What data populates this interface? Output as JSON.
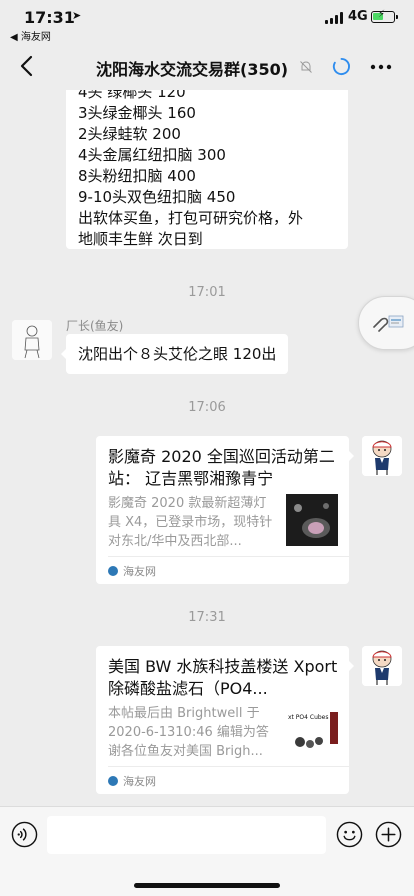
{
  "status_bar": {
    "time": "17:31",
    "back_app": "◀ 海友网",
    "network": "4G",
    "battery_charging": true
  },
  "nav": {
    "title": "沈阳海水交流交易群(350)"
  },
  "messages": {
    "top_bubble_lines": [
      "4头 绿椰头 120",
      "3头绿金椰头 160",
      "2头绿蛙软 200",
      "4头金属红纽扣脑 300",
      "8头粉纽扣脑 400",
      "9-10头双色纽扣脑 450",
      "出软体买鱼，打包可研究价格，外",
      "地顺丰生鲜 次日到"
    ],
    "time1": "17:01",
    "sender_name": "厂长(鱼友)",
    "left_bubble": "沈阳出个８头艾伦之眼 120出",
    "time2": "17:06",
    "card1": {
      "title": "影魔奇 2020 全国巡回活动第二站： 辽吉黑鄂湘豫青宁",
      "description": "影魔奇 2020 款最新超薄灯具 X4，已登录市场，现特针对东北/华中及西北部...",
      "source": "海友网"
    },
    "time3": "17:31",
    "card2": {
      "title": "美国 BW 水族科技盖楼送 Xport 除磷酸盐滤石（PO4...",
      "description": "本帖最后由 Brightwell 于 2020-6-1310:46 编辑为答谢各位鱼友对美国 Brigh...",
      "thumb_text": "xt PO4 Cubes",
      "source": "海友网"
    }
  },
  "input_bar": {
    "placeholder": ""
  },
  "colors": {
    "background": "#ededed",
    "bubble": "#ffffff",
    "timestamp": "#9a9a9a",
    "loading_accent": "#2f8dee",
    "battery_green": "#4cd964"
  }
}
